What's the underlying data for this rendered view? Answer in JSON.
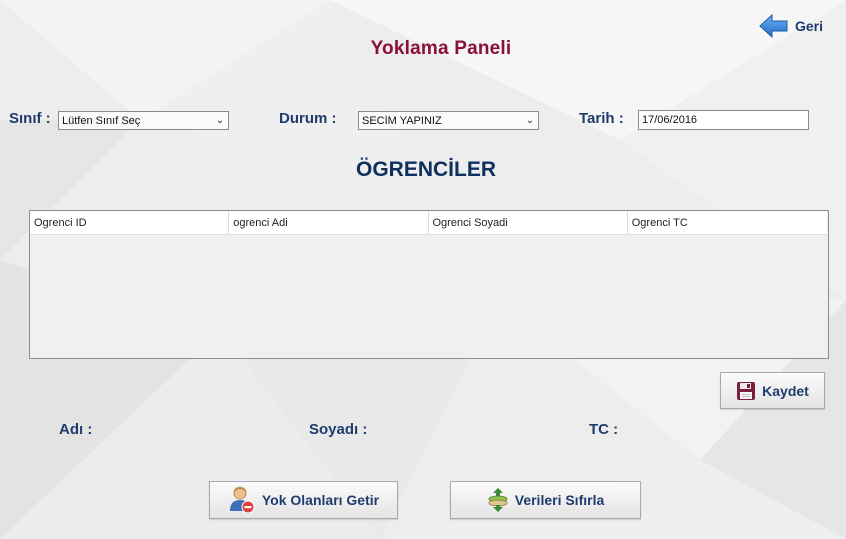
{
  "header": {
    "title": "Yoklama  Paneli",
    "back_label": "Geri"
  },
  "filters": {
    "class_label": "Sınıf :",
    "class_value": "Lütfen Sınıf Seç",
    "status_label": "Durum :",
    "status_value": "SECİM YAPINIZ",
    "date_label": "Tarih :",
    "date_value": "17/06/2016"
  },
  "students": {
    "title": "ÖGRENCİLER",
    "columns": [
      "Ogrenci ID",
      "ogrenci Adi",
      "Ogrenci Soyadi",
      "Ogrenci TC"
    ],
    "rows": []
  },
  "details": {
    "name_label": "Adı :",
    "surname_label": "Soyadı :",
    "tc_label": "TC :"
  },
  "actions": {
    "save_label": "Kaydet",
    "absent_label": "Yok Olanları Getir",
    "reset_label": "Verileri Sıfırla"
  },
  "icons": {
    "back": "arrow-left-icon",
    "save": "floppy-disk-icon",
    "absent": "user-remove-icon",
    "reset": "reset-stack-icon"
  },
  "colors": {
    "title": "#8a1038",
    "label": "#1e3c6e",
    "section_title": "#0f2f5e",
    "arrow": "#2f7fd6"
  }
}
